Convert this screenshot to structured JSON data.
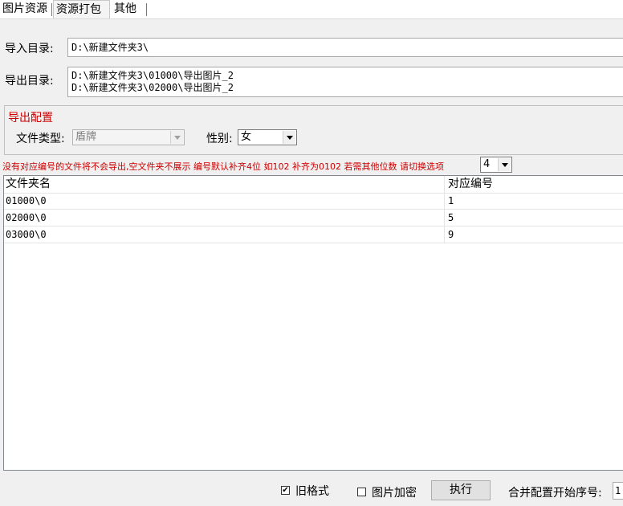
{
  "tabs": [
    {
      "label": "图片资源",
      "active": false
    },
    {
      "label": "资源打包",
      "active": true
    },
    {
      "label": "其他",
      "active": false
    }
  ],
  "import_dir": {
    "label": "导入目录:",
    "value": "D:\\新建文件夹3\\"
  },
  "export_dir": {
    "label": "导出目录:",
    "lines": [
      "D:\\新建文件夹3\\01000\\导出图片_2",
      "D:\\新建文件夹3\\02000\\导出图片_2"
    ]
  },
  "export_config": {
    "title": "导出配置",
    "file_type_label": "文件类型:",
    "file_type_value": "盾牌",
    "gender_label": "性别:",
    "gender_value": "女"
  },
  "note": {
    "text": "没有对应编号的文件将不会导出,空文件夹不展示 编号默认补齐4位 如102 补齐为0102 若需其他位数 请切换选项",
    "digits_value": "4"
  },
  "table": {
    "columns": [
      "文件夹名",
      "对应编号"
    ],
    "rows": [
      [
        "01000\\0",
        "1"
      ],
      [
        "02000\\0",
        "5"
      ],
      [
        "03000\\0",
        "9"
      ]
    ]
  },
  "bottom": {
    "old_format_label": "旧格式",
    "old_format_checked": true,
    "encrypt_label": "图片加密",
    "encrypt_checked": false,
    "execute_label": "执行",
    "merge_start_label": "合并配置开始序号:",
    "merge_start_value": "1"
  },
  "colors": {
    "accent_red": "#cc0000",
    "background": "#f0f0f0"
  }
}
